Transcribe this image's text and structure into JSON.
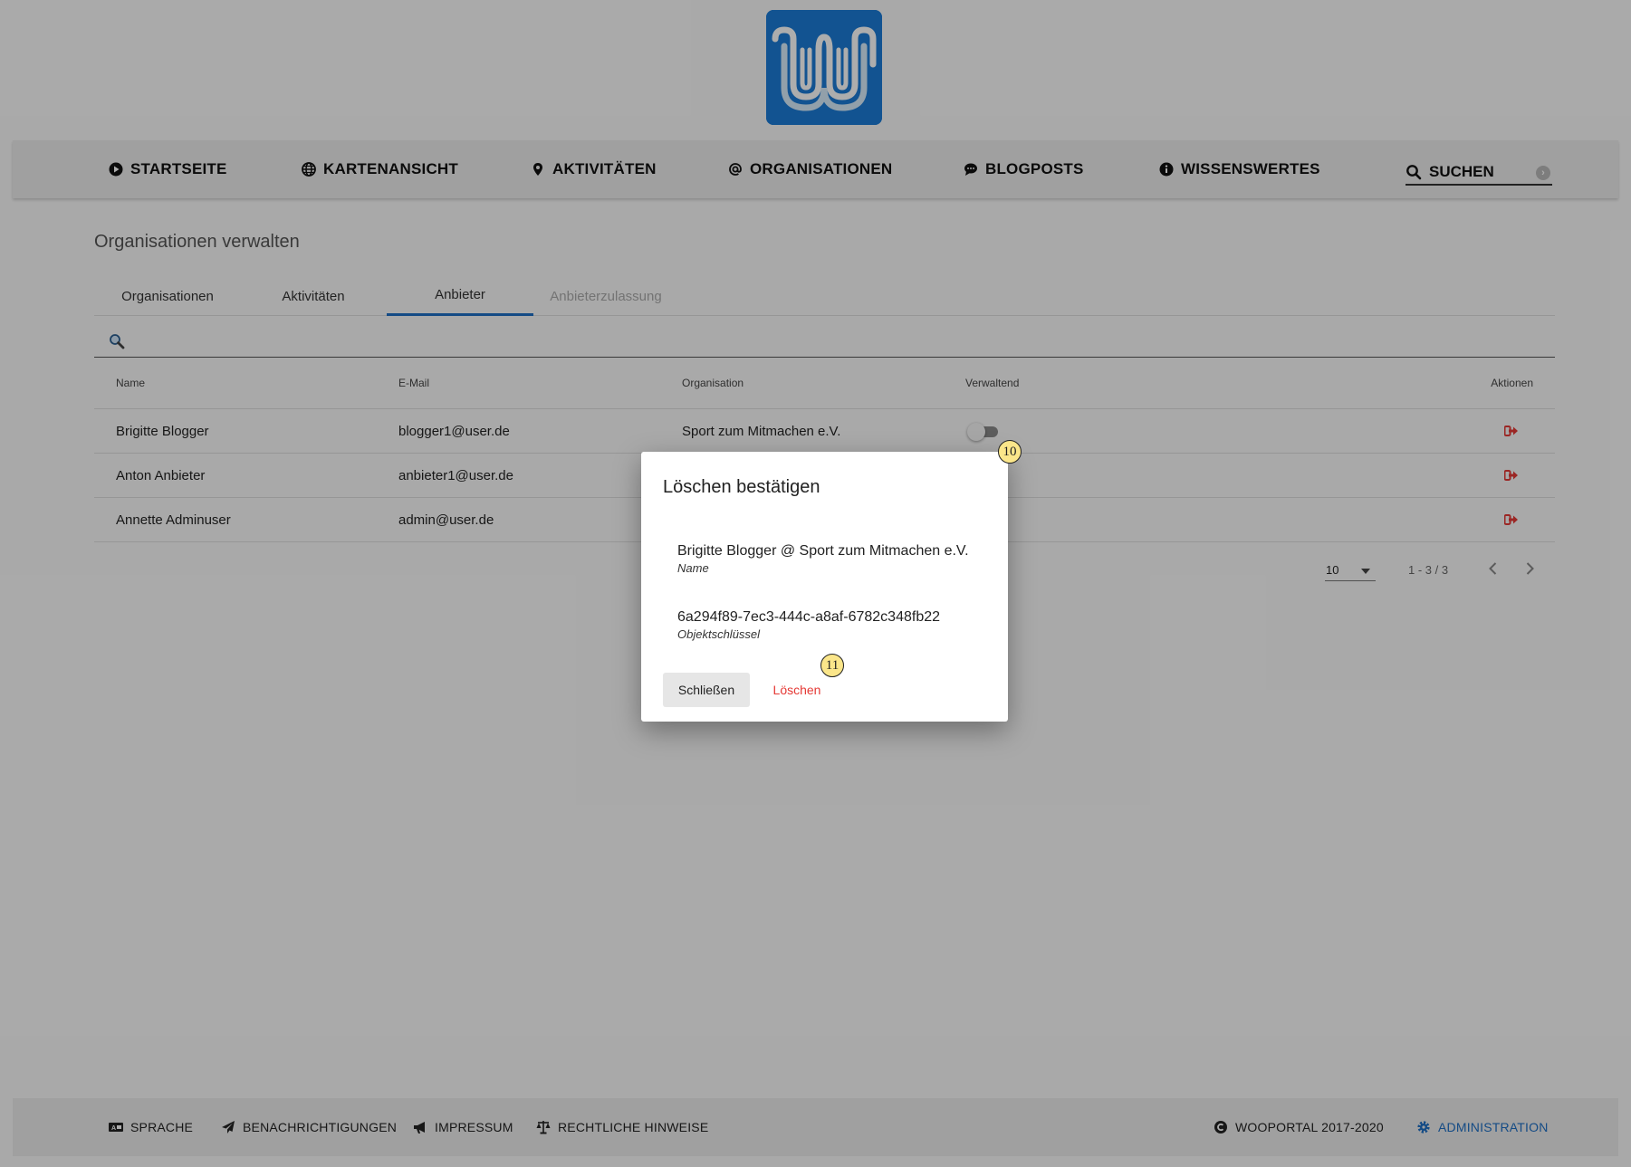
{
  "nav": {
    "items": [
      {
        "label": "STARTSEITE",
        "icon": "play-circle-icon"
      },
      {
        "label": "KARTENANSICHT",
        "icon": "globe-icon"
      },
      {
        "label": "AKTIVITÄTEN",
        "icon": "map-pin-icon"
      },
      {
        "label": "ORGANISATIONEN",
        "icon": "at-icon"
      },
      {
        "label": "BLOGPOSTS",
        "icon": "comment-icon"
      },
      {
        "label": "WISSENSWERTES",
        "icon": "info-icon"
      }
    ],
    "search_label": "SUCHEN"
  },
  "page": {
    "title": "Organisationen verwalten",
    "tabs": [
      "Organisationen",
      "Aktivitäten",
      "Anbieter",
      "Anbieterzulassung"
    ],
    "active_tab": "Anbieter",
    "disabled_tab": "Anbieterzulassung"
  },
  "table": {
    "headers": {
      "name": "Name",
      "email": "E-Mail",
      "organisation": "Organisation",
      "verwaltend": "Verwaltend",
      "aktionen": "Aktionen"
    },
    "rows": [
      {
        "name": "Brigitte Blogger",
        "email": "blogger1@user.de",
        "organisation": "Sport zum Mitmachen e.V.",
        "verwaltend": false
      },
      {
        "name": "Anton Anbieter",
        "email": "anbieter1@user.de",
        "organisation": "",
        "verwaltend": null
      },
      {
        "name": "Annette Adminuser",
        "email": "admin@user.de",
        "organisation": "",
        "verwaltend": null
      }
    ]
  },
  "pager": {
    "page_size": "10",
    "range": "1 - 3 / 3"
  },
  "dialog": {
    "title": "Löschen bestätigen",
    "name_value": "Brigitte Blogger @ Sport zum Mitmachen e.V.",
    "name_label": "Name",
    "key_value": "6a294f89-7ec3-444c-a8af-6782c348fb22",
    "key_label": "Objektschlüssel",
    "close_label": "Schließen",
    "delete_label": "Löschen"
  },
  "markers": {
    "m10": "10",
    "m11": "11"
  },
  "footer": {
    "sprache": "SPRACHE",
    "benachrichtigungen": "BENACHRICHTIGUNGEN",
    "impressum": "IMPRESSUM",
    "hinweise": "RECHTLICHE HINWEISE",
    "copyright": "WOOPORTAL 2017-2020",
    "admin": "ADMINISTRATION"
  },
  "colors": {
    "brand": "#1b7bd6",
    "accent": "#1e6fc4",
    "danger": "#e53935",
    "marker": "#fbe68a"
  }
}
